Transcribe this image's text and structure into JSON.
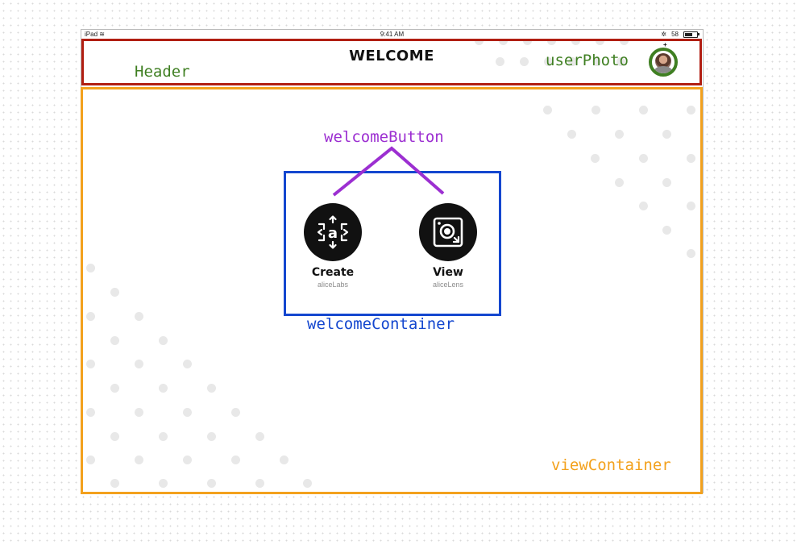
{
  "status_bar": {
    "device": "iPad",
    "time": "9:41 AM",
    "battery_percent": "58"
  },
  "header": {
    "title": "WELCOME"
  },
  "annotations": {
    "header": "Header",
    "user_photo": "userPhoto",
    "welcome_button": "welcomeButton",
    "welcome_container": "welcomeContainer",
    "view_container": "viewContainer"
  },
  "welcome_buttons": [
    {
      "label": "Create",
      "sublabel": "aliceLabs",
      "icon": "create-icon"
    },
    {
      "label": "View",
      "sublabel": "aliceLens",
      "icon": "view-icon"
    }
  ],
  "colors": {
    "header_outline": "#b11e12",
    "view_container_outline": "#f3a11d",
    "welcome_container_outline": "#1447cf",
    "welcome_button_annotation": "#9c2fd1",
    "user_photo_annotation": "#3f7f22"
  }
}
